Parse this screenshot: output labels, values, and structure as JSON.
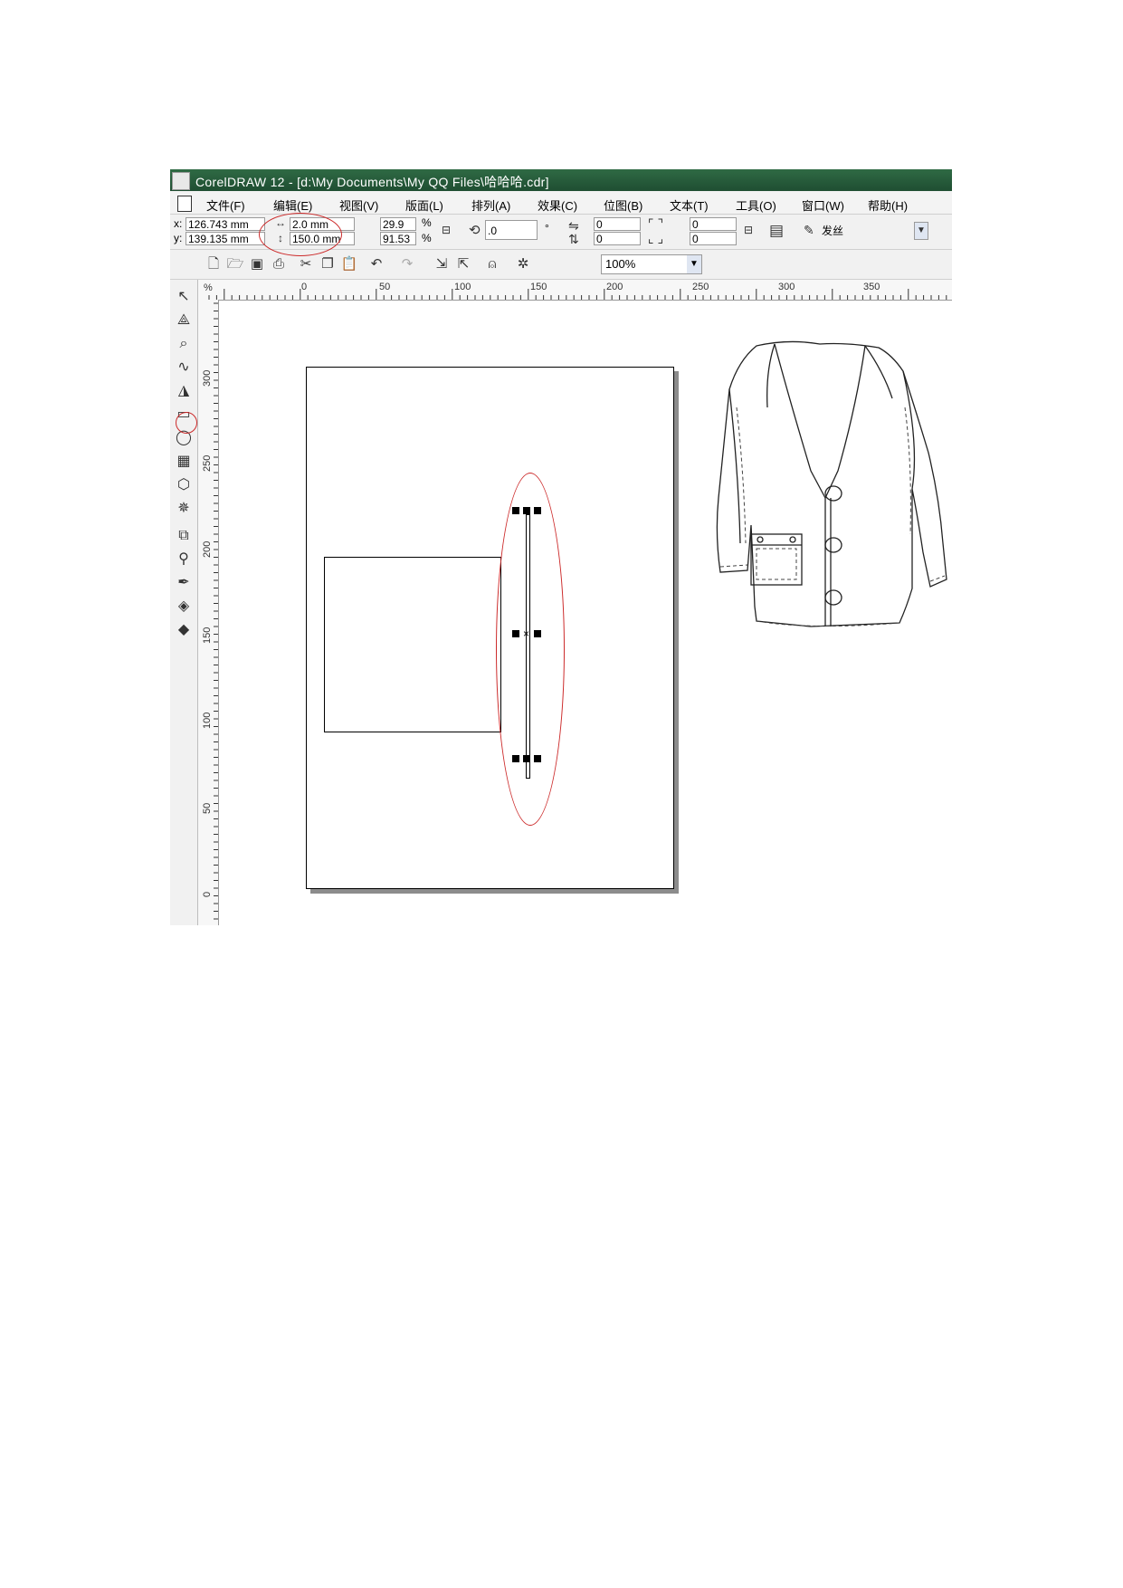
{
  "window": {
    "title": "CorelDRAW 12 - [d:\\My Documents\\My QQ Files\\哈哈哈.cdr]"
  },
  "menu": [
    "文件(F)",
    "编辑(E)",
    "视图(V)",
    "版面(L)",
    "排列(A)",
    "效果(C)",
    "位图(B)",
    "文本(T)",
    "工具(O)",
    "窗口(W)",
    "帮助(H)"
  ],
  "property_bar": {
    "x_label": "x:",
    "x_value": "126.743 mm",
    "y_label": "y:",
    "y_value": "139.135 mm",
    "width_value": "2.0 mm",
    "height_value": "150.0 mm",
    "scale_x": "29.9",
    "scale_y": "91.53",
    "percent": "%",
    "rotation": ".0",
    "degree": "°",
    "corner_tl": "0",
    "corner_bl": "0",
    "corner_tr": "0",
    "corner_br": "0",
    "outline_width": "发丝"
  },
  "toolbar": {
    "zoom_level": "100%"
  },
  "ruler": {
    "unit_corner": "%",
    "h_ticks": [
      "0",
      "50",
      "100",
      "150",
      "200",
      "250",
      "300",
      "350"
    ],
    "v_ticks": [
      "300",
      "250",
      "200",
      "150",
      "100",
      "50",
      "0"
    ]
  },
  "colors": {
    "title_bar": "#2b603f",
    "annotation": "#cc2a2a",
    "page_shadow": "#8c8c8c"
  }
}
